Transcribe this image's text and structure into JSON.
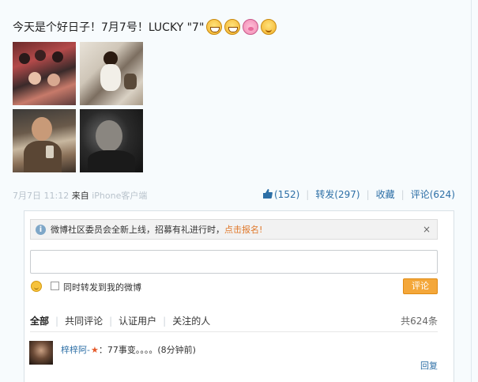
{
  "post": {
    "text": "今天是个好日子！7月7号！LUCKY \"7\"",
    "emojis": [
      "grin-icon",
      "grin-icon",
      "pig-icon",
      "wink-icon"
    ],
    "photos": [
      "photo-group",
      "photo-restaurant",
      "photo-selfie",
      "photo-portrait"
    ]
  },
  "meta": {
    "date": "7月7日 11:12",
    "source_prefix": "来自",
    "source": "iPhone客户端"
  },
  "actions": {
    "like_count": "(152)",
    "repost_label": "转发(297)",
    "favorite_label": "收藏",
    "comment_label": "评论(624)"
  },
  "notice": {
    "info_icon": "i",
    "text": "微博社区委员会全新上线，招募有礼进行时，",
    "link": "点击报名!",
    "close": "×"
  },
  "composer": {
    "input_value": "",
    "repost_checkbox_label": "同时转发到我的微博",
    "submit_label": "评论"
  },
  "filters": {
    "items": [
      "全部",
      "共同评论",
      "认证用户",
      "关注的人"
    ],
    "total": "共624条"
  },
  "comment": {
    "user": "梓梓阿-",
    "badge": "★",
    "text": "：77事变。。。。",
    "time": "(8分钟前)",
    "reply_label": "回复"
  },
  "colors": {
    "link_blue": "#2d6fa6",
    "accent_orange": "#e0782a",
    "submit_orange": "#f4a73a"
  }
}
